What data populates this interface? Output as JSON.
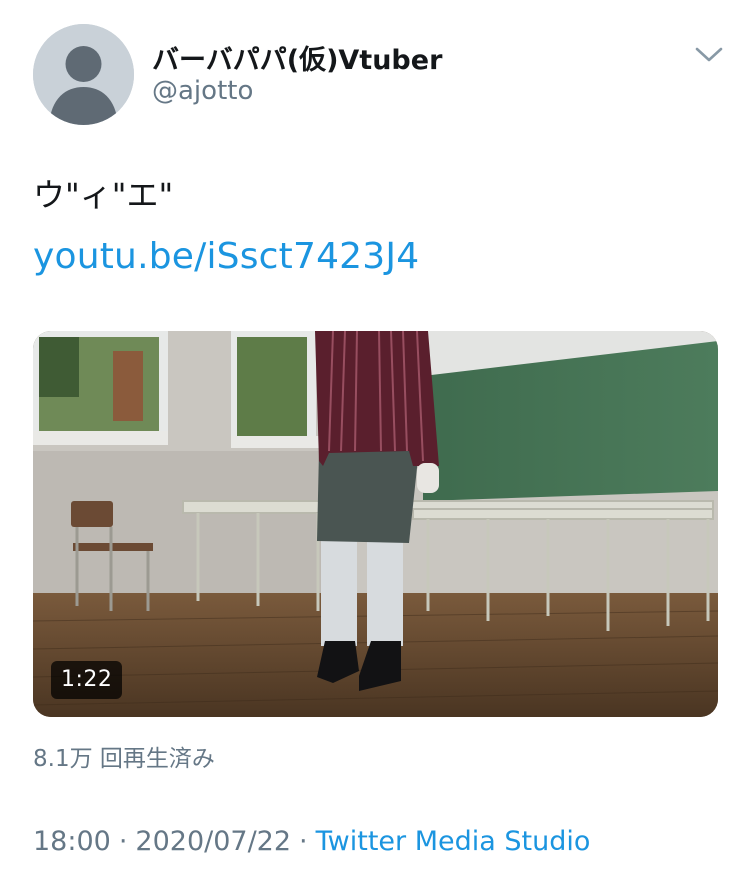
{
  "author": {
    "display_name": "バーバパパ(仮)Vtuber",
    "handle": "@ajotto",
    "avatar_icon": "default-avatar-icon"
  },
  "menu": {
    "icon": "chevron-down-icon"
  },
  "tweet": {
    "text": "ウ\"ィ\"エ\"",
    "link_text": "youtu.be/iSsct7423J4"
  },
  "media": {
    "duration": "1:22",
    "views": "8.1万 回再生済み"
  },
  "meta": {
    "time": "18:00",
    "separator": "·",
    "date": "2020/07/22",
    "source": "Twitter Media Studio"
  },
  "colors": {
    "link": "#1b95e0",
    "secondary_text": "#657786",
    "primary_text": "#14171a",
    "avatar_bg": "#c9d1d8"
  }
}
